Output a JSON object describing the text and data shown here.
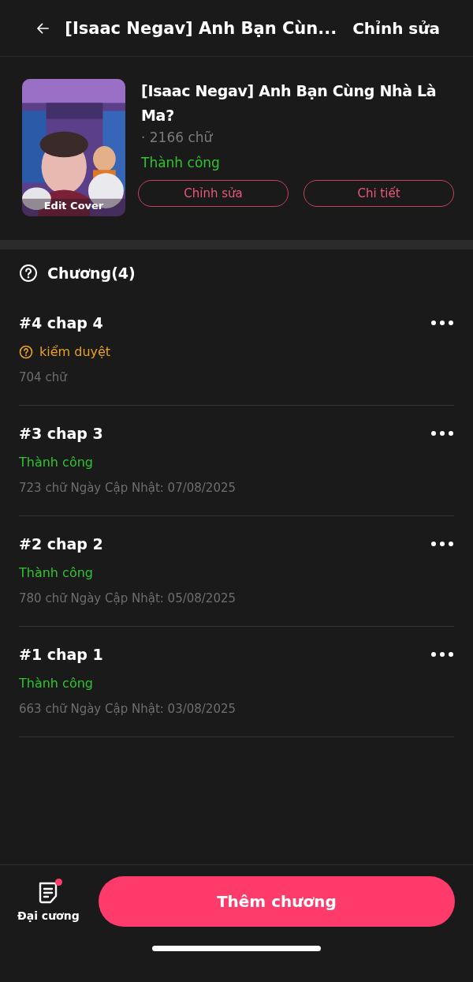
{
  "header": {
    "title": "[Isaac Negav] Anh Bạn Cùn...",
    "action": "Chỉnh sửa"
  },
  "book": {
    "cover": {
      "kind": "picture",
      "overlay": "Edit Cover"
    },
    "title": "[Isaac Negav] Anh Bạn Cùng Nhà Là Ma?",
    "words": "· 2166 chữ",
    "status": "Thành công",
    "buttons": [
      "Chỉnh sửa",
      "Chi tiết"
    ]
  },
  "chapters_heading": "Chương(4)",
  "chapters": [
    {
      "title": "#4 chap 4",
      "status": {
        "kind": "review",
        "text": "kiểm duyệt"
      },
      "meta": "704 chữ"
    },
    {
      "title": "#3 chap 3",
      "status": {
        "kind": "success",
        "text": "Thành công"
      },
      "meta": "723 chữ Ngày Cập Nhật: 07/08/2025"
    },
    {
      "title": "#2 chap 2",
      "status": {
        "kind": "success",
        "text": "Thành công"
      },
      "meta": "780 chữ Ngày Cập Nhật: 05/08/2025"
    },
    {
      "title": "#1 chap 1",
      "status": {
        "kind": "success",
        "text": "Thành công"
      },
      "meta": "663 chữ Ngày Cập Nhật: 03/08/2025"
    }
  ],
  "bottom": {
    "outline": {
      "label": "Đại cương",
      "badge": true
    },
    "add_button": "Thêm chương"
  }
}
